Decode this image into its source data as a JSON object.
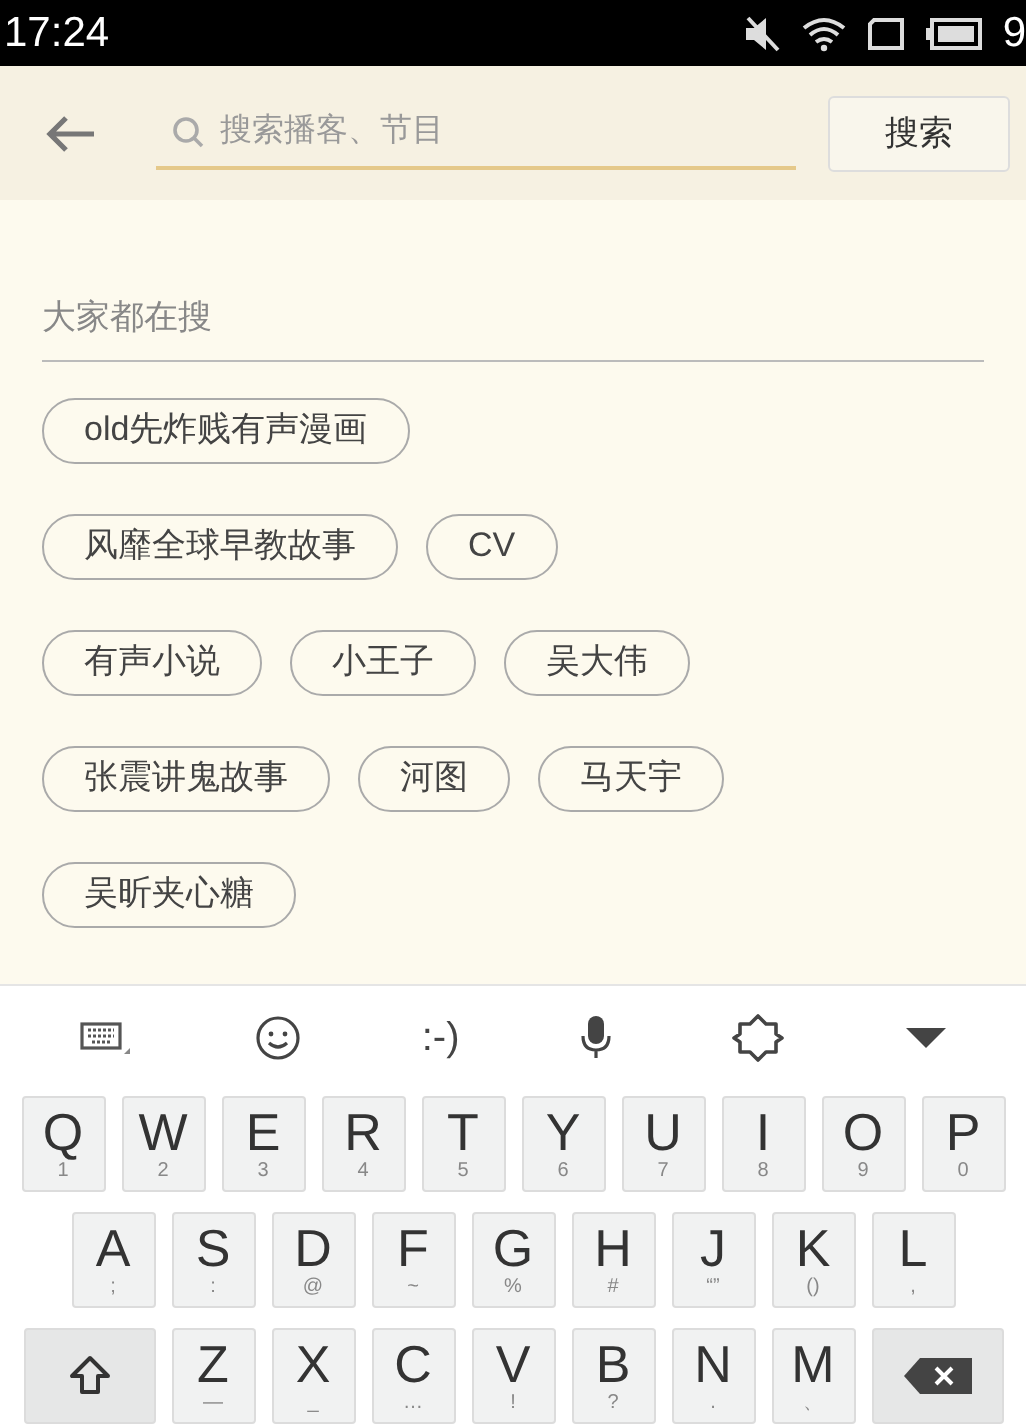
{
  "status_bar": {
    "time": "17:24",
    "battery": "9"
  },
  "header": {
    "search": {
      "placeholder": "搜索播客、节目"
    },
    "search_button": "搜索"
  },
  "hot": {
    "title": "大家都在搜",
    "tags": [
      [
        "old先炸贱有声漫画"
      ],
      [
        "风靡全球早教故事",
        "CV"
      ],
      [
        "有声小说",
        "小王子",
        "吴大伟"
      ],
      [
        "张震讲鬼故事",
        "河图",
        "马天宇"
      ],
      [
        "吴昕夹心糖"
      ]
    ]
  },
  "keyboard": {
    "toolbar": [
      {
        "kind": "keyboard"
      },
      {
        "kind": "emoji"
      },
      {
        "kind": "text",
        "label": ":-)"
      },
      {
        "kind": "mic"
      },
      {
        "kind": "settings"
      },
      {
        "kind": "hide"
      }
    ],
    "rows": [
      [
        {
          "kind": "key",
          "label": "Q",
          "sub": "1"
        },
        {
          "kind": "key",
          "label": "W",
          "sub": "2"
        },
        {
          "kind": "key",
          "label": "E",
          "sub": "3"
        },
        {
          "kind": "key",
          "label": "R",
          "sub": "4"
        },
        {
          "kind": "key",
          "label": "T",
          "sub": "5"
        },
        {
          "kind": "key",
          "label": "Y",
          "sub": "6"
        },
        {
          "kind": "key",
          "label": "U",
          "sub": "7"
        },
        {
          "kind": "key",
          "label": "I",
          "sub": "8"
        },
        {
          "kind": "key",
          "label": "O",
          "sub": "9"
        },
        {
          "kind": "key",
          "label": "P",
          "sub": "0"
        }
      ],
      [
        {
          "kind": "key",
          "label": "A",
          "sub": ";"
        },
        {
          "kind": "key",
          "label": "S",
          "sub": ":"
        },
        {
          "kind": "key",
          "label": "D",
          "sub": "@"
        },
        {
          "kind": "key",
          "label": "F",
          "sub": "~"
        },
        {
          "kind": "key",
          "label": "G",
          "sub": "%"
        },
        {
          "kind": "key",
          "label": "H",
          "sub": "#"
        },
        {
          "kind": "key",
          "label": "J",
          "sub": "“”"
        },
        {
          "kind": "key",
          "label": "K",
          "sub": "()"
        },
        {
          "kind": "key",
          "label": "L",
          "sub": ","
        }
      ],
      [
        {
          "kind": "shift"
        },
        {
          "kind": "key",
          "label": "Z",
          "sub": "—"
        },
        {
          "kind": "key",
          "label": "X",
          "sub": "_"
        },
        {
          "kind": "key",
          "label": "C",
          "sub": "…"
        },
        {
          "kind": "key",
          "label": "V",
          "sub": "!"
        },
        {
          "kind": "key",
          "label": "B",
          "sub": "?"
        },
        {
          "kind": "key",
          "label": "N",
          "sub": "."
        },
        {
          "kind": "key",
          "label": "M",
          "sub": "、"
        },
        {
          "kind": "backspace"
        }
      ]
    ]
  }
}
